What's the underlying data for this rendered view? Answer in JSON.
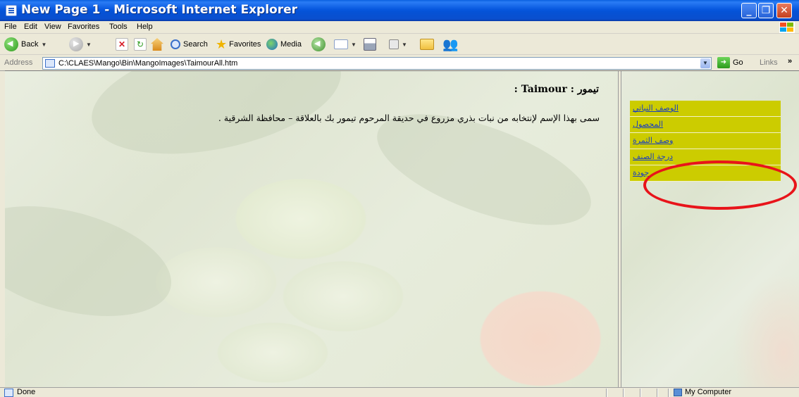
{
  "window": {
    "title": "New Page 1 - Microsoft Internet Explorer",
    "controls": {
      "minimize": "_",
      "maximize": "❐",
      "close": "✕"
    }
  },
  "menubar": {
    "items": [
      "File",
      "Edit",
      "View",
      "Favorites",
      "Tools",
      "Help"
    ]
  },
  "toolbar": {
    "back_label": "Back",
    "search_label": "Search",
    "favorites_label": "Favorites",
    "media_label": "Media"
  },
  "addressbar": {
    "label": "Address",
    "url": "C:\\CLAES\\Mango\\Bin\\MangoImages\\TaimourAll.htm",
    "go_label": "Go",
    "links_label": "Links",
    "links_chevron": "»"
  },
  "main": {
    "heading": "تيمور : Taimour :",
    "body": "سمى بهذا الإسم لإنتخابه من نبات بذري مزروع في حديقة المرحوم تيمور بك بالعلاقة – محافظة الشرقية ."
  },
  "nav": {
    "items": [
      {
        "label": "الوصف النباتي"
      },
      {
        "label": "المحصول"
      },
      {
        "label": "وصف الثمرة"
      },
      {
        "label": "درجة الصنف"
      },
      {
        "label": "جودة"
      }
    ]
  },
  "annotation": {
    "color": "#e8141a"
  },
  "statusbar": {
    "status": "Done",
    "zone": "My Computer"
  },
  "colors": {
    "titlebar": "#0757de",
    "nav_background": "#cccc00",
    "link": "#1a3fc0"
  }
}
